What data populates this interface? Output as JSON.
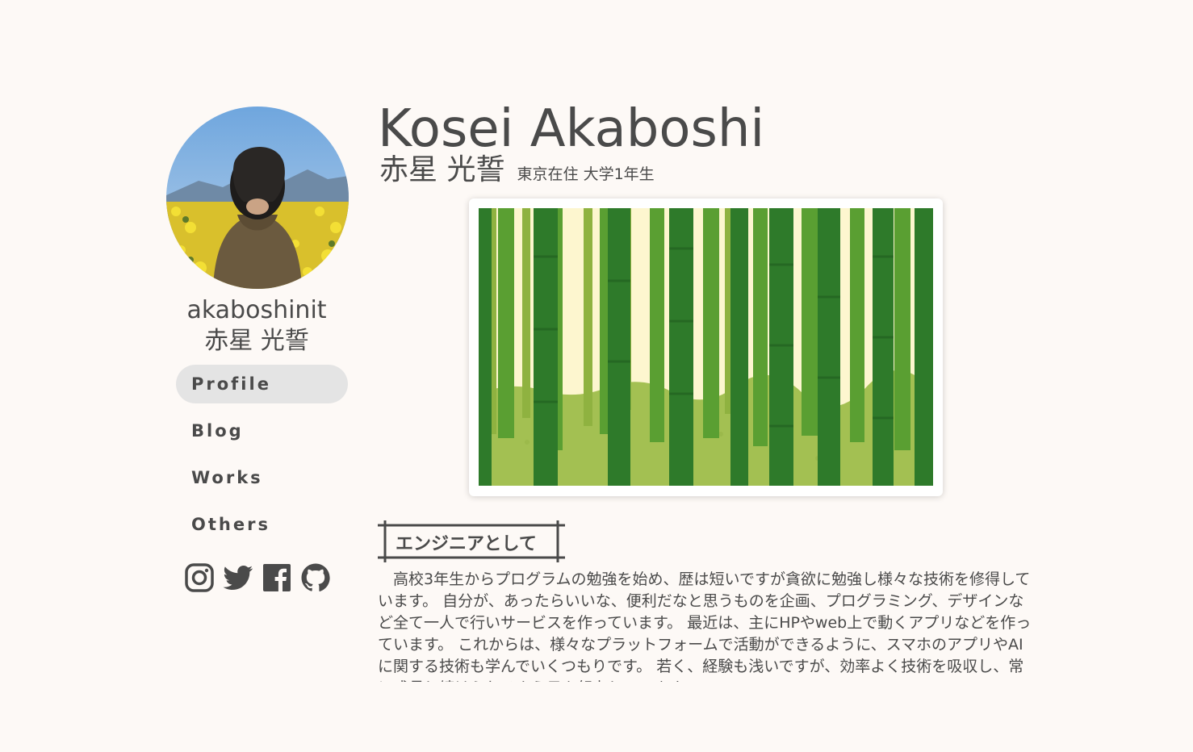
{
  "colors": {
    "background": "#fdf9f6",
    "text": "#4a4a4a",
    "nav_active": "#e4e4e4"
  },
  "sidebar": {
    "username": "akaboshinit",
    "name_ja": "赤星 光誓",
    "nav": [
      {
        "label": "Profile",
        "active": true
      },
      {
        "label": "Blog",
        "active": false
      },
      {
        "label": "Works",
        "active": false
      },
      {
        "label": "Others",
        "active": false
      }
    ],
    "social_icons": [
      "instagram-icon",
      "twitter-icon",
      "facebook-icon",
      "github-icon"
    ]
  },
  "header": {
    "name_en": "Kosei Akaboshi",
    "name_ja": "赤星 光誓",
    "status": "東京在住 大学1年生"
  },
  "section": {
    "heading": "エンジニアとして",
    "body": "高校3年生からプログラムの勉強を始め、歴は短いですが貪欲に勉強し様々な技術を修得しています。 自分が、あったらいいな、便利だなと思うものを企画、プログラミング、デザインなど全て一人で行いサービスを作っています。 最近は、主にHPやweb上で動くアプリなどを作っています。 これからは、様々なプラットフォームで活動ができるように、スマホのアプリやAIに関する技術も学んでいくつもりです。 若く、経験も浅いですが、効率よく技術を吸収し、常に成長し続けられるよう日々努力しています。"
  }
}
